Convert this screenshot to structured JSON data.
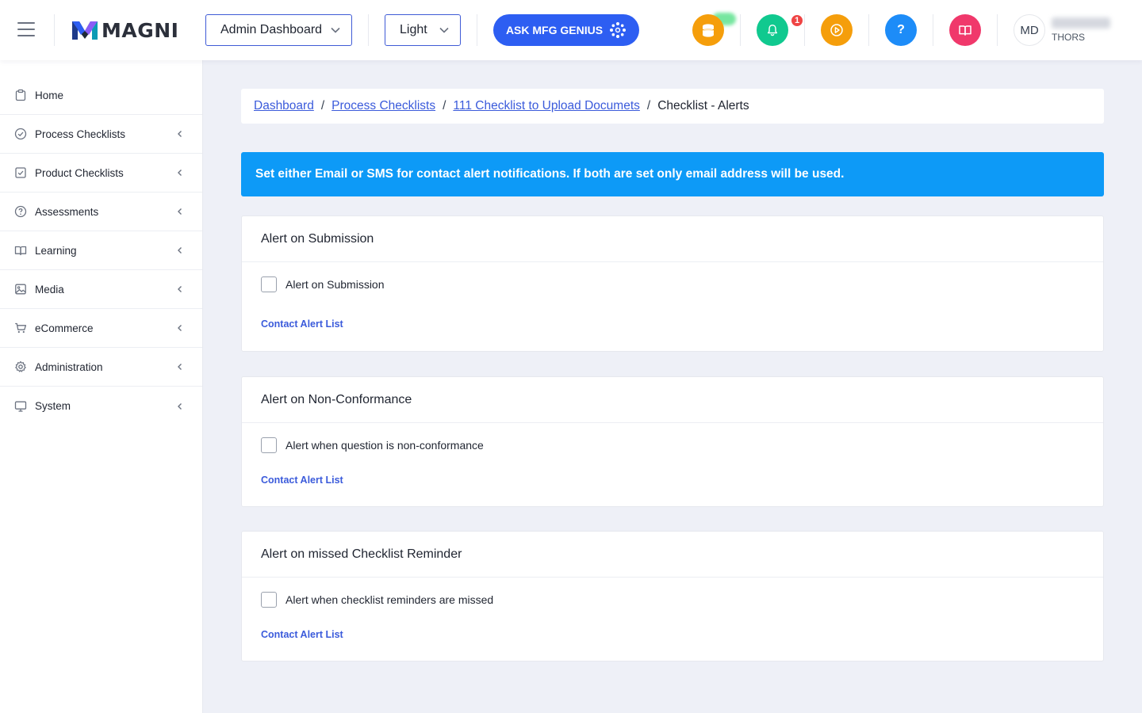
{
  "brand": {
    "logo_text": "MAGNI"
  },
  "header": {
    "dashboard_select": "Admin Dashboard",
    "theme_select": "Light",
    "genius_button": "ASK MFG GENIUS",
    "notification_count": "1",
    "help_label": "?",
    "user_initials": "MD",
    "user_org": "THORS"
  },
  "sidebar": {
    "items": [
      {
        "label": "Home",
        "icon": "clipboard-icon",
        "has_arrow": false
      },
      {
        "label": "Process Checklists",
        "icon": "check-circle-icon",
        "has_arrow": true
      },
      {
        "label": "Product Checklists",
        "icon": "check-square-icon",
        "has_arrow": true
      },
      {
        "label": "Assessments",
        "icon": "question-circle-icon",
        "has_arrow": true
      },
      {
        "label": "Learning",
        "icon": "book-open-icon",
        "has_arrow": true
      },
      {
        "label": "Media",
        "icon": "image-icon",
        "has_arrow": true
      },
      {
        "label": "eCommerce",
        "icon": "cart-icon",
        "has_arrow": true
      },
      {
        "label": "Administration",
        "icon": "gear-icon",
        "has_arrow": true
      },
      {
        "label": "System",
        "icon": "monitor-icon",
        "has_arrow": true
      }
    ]
  },
  "breadcrumb": {
    "items": [
      "Dashboard",
      "Process Checklists",
      "111 Checklist to Upload Documets"
    ],
    "current": "Checklist - Alerts",
    "separator": "/"
  },
  "info_banner": "Set either Email or SMS for contact alert notifications. If both are set only email address will be used.",
  "cards": [
    {
      "title": "Alert on Submission",
      "checkbox_label": "Alert on Submission",
      "checked": false,
      "link": "Contact Alert List"
    },
    {
      "title": "Alert on Non-Conformance",
      "checkbox_label": "Alert when question is non-conformance",
      "checked": false,
      "link": "Contact Alert List"
    },
    {
      "title": "Alert on missed Checklist Reminder",
      "checkbox_label": "Alert when checklist reminders are missed",
      "checked": false,
      "link": "Contact Alert List"
    }
  ],
  "colors": {
    "primary": "#2d5ef2",
    "banner": "#0d9af7",
    "link": "#3b5bdb",
    "coins": "#f59e0b",
    "bell": "#10c98f",
    "play": "#f59e0b",
    "help": "#1d8cf8",
    "book": "#f0386b",
    "badge": "#ef4444"
  }
}
